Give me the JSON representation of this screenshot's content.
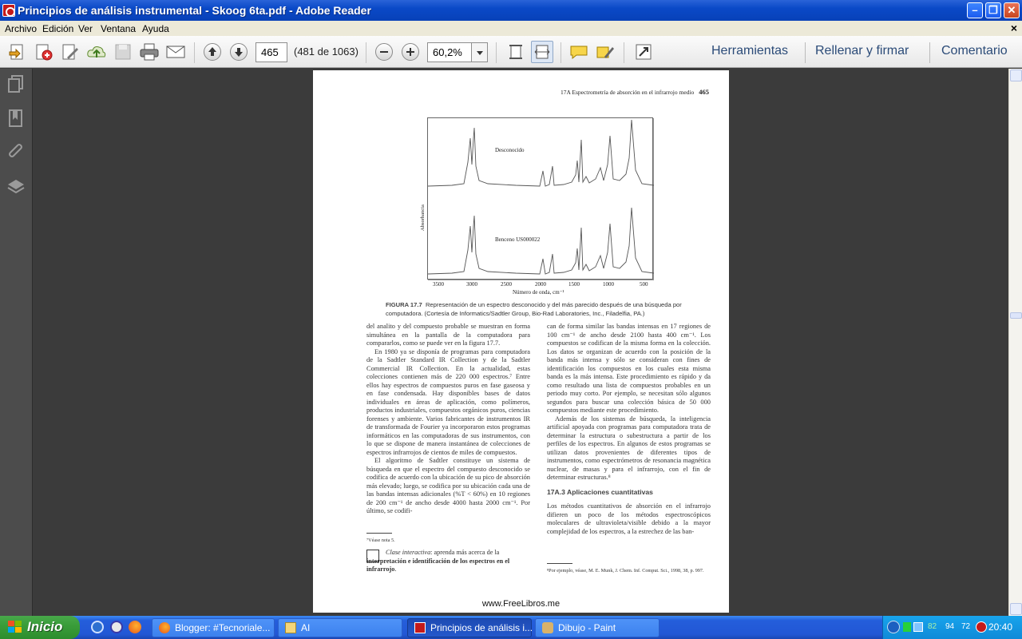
{
  "window": {
    "title": "Principios de análisis instrumental - Skoog 6ta.pdf - Adobe Reader"
  },
  "menu": [
    "Archivo",
    "Edición",
    "Ver",
    "Ventana",
    "Ayuda"
  ],
  "toolbar": {
    "page_number": "465",
    "page_count": "(481 de 1063)",
    "zoom": "60,2%",
    "links": [
      "Herramientas",
      "Rellenar y firmar",
      "Comentario"
    ]
  },
  "document": {
    "running_head": "17A Espectrometría de absorción en el infrarrojo medio",
    "page_no": "465",
    "figure": {
      "label_top": "Desconocido",
      "label_bottom": "Benceno US000022",
      "y_axis": "Absorbancia",
      "x_axis": "Número de onda, cm⁻¹",
      "x_ticks": [
        "3500",
        "3000",
        "2500",
        "2000",
        "1500",
        "1000",
        "500"
      ]
    },
    "caption_label": "FIGURA 17.7",
    "caption_text": "Representación de un espectro desconocido y del más parecido después de una búsqueda por computadora. (Cortesía de Informatics/Sadtler Group, Bio-Rad Laboratories, Inc., Filadelfia, PA.)",
    "left_paragraphs": [
      "del analito y del compuesto probable se muestran en forma simultánea en la pantalla de la computadora para compararlos, como se puede ver en la figura 17.7.",
      "En 1980 ya se disponía de programas para computadora de la Sadtler Standard IR Collection y de la Sadtler Commercial IR Collection. En la actualidad, estas colecciones contienen más de 220 000 espectros.⁷ Entre ellos hay espectros de compuestos puros en fase gaseosa y en fase condensada. Hay disponibles bases de datos individuales en áreas de aplicación, como polímeros, productos industriales, compuestos orgánicos puros, ciencias forenses y ambiente. Varios fabricantes de instrumentos IR de transformada de Fourier ya incorporaron estos programas informáticos en las computadoras de sus instrumentos, con lo que se dispone de manera instantánea de colecciones de espectros infrarrojos de cientos de miles de compuestos.",
      "El algoritmo de Sadtler constituye un sistema de búsqueda en que el espectro del compuesto desconocido se codifica de acuerdo con la ubicación de su pico de absorción más elevado; luego, se codifica por su ubicación cada una de las bandas intensas adicionales (%T < 60%) en 10 regiones de 200 cm⁻¹ de ancho desde 4000 hasta 2000 cm⁻¹. Por último, se codifi-"
    ],
    "left_footnote": "⁷Véase nota 5.",
    "interactive_italic": "Clase interactiva",
    "interactive_text": ": aprenda más acerca de la ",
    "interactive_bold": "interpretación e identificación de los espectros en el infrarrojo",
    "interactive_end": ".",
    "right_paragraphs": [
      "can de forma similar las bandas intensas en 17 regiones de 100 cm⁻¹ de ancho desde 2100 hasta 400 cm⁻¹. Los compuestos se codifican de la misma forma en la colección. Los datos se organizan de acuerdo con la posición de la banda más intensa y sólo se consideran con fines de identificación los compuestos en los cuales esta misma banda es la más intensa. Este procedimiento es rápido y da como resultado una lista de compuestos probables en un periodo muy corto. Por ejemplo, se necesitan sólo algunos segundos para buscar una colección básica de 50 000 compuestos mediante este procedimiento.",
      "Además de los sistemas de búsqueda, la inteligencia artificial apoyada con programas para computadora trata de determinar la estructura o subestructura a partir de los perfiles de los espectros. En algunos de estos programas se utilizan datos provenientes de diferentes tipos de instrumentos, como espectrómetros de resonancia magnética nuclear, de masas y para el infrarrojo, con el fin de determinar estructuras.⁸"
    ],
    "section_heading": "17A.3 Aplicaciones cuantitativas",
    "section_text": "Los métodos cuantitativos de absorción en el infrarrojo difieren un poco de los métodos espectroscópicos moleculares de ultravioleta/visible debido a la mayor complejidad de los espectros, a la estrechez de las ban-",
    "right_footnote": "⁸Por ejemplo, véase, M. E. Munk, J. Chem. Inf. Comput. Sci., 1998, 38, p. 997.",
    "site": "www.FreeLibros.me"
  },
  "taskbar": {
    "start": "Inicio",
    "tasks": [
      "Blogger: #Tecnoriale...",
      "AI",
      "Principios de análisis i...",
      "Dibujo - Paint"
    ],
    "tray_stats": [
      "82",
      "94",
      "72"
    ],
    "clock": "20:40"
  }
}
